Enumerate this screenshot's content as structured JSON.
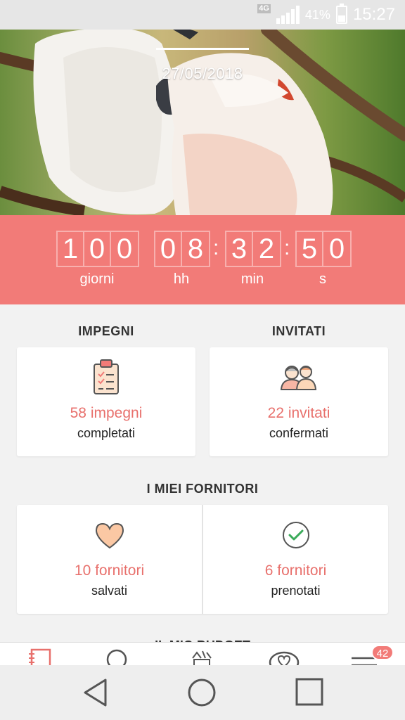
{
  "status_bar": {
    "network": "4G",
    "battery_percent": "41%",
    "battery_level": 0.41,
    "time": "15:27"
  },
  "hero": {
    "date": "27/05/2018"
  },
  "countdown": {
    "days": [
      "1",
      "0",
      "0"
    ],
    "hours": [
      "0",
      "8"
    ],
    "minutes": [
      "3",
      "2"
    ],
    "seconds": [
      "5",
      "0"
    ],
    "separator": ":",
    "labels": {
      "days": "giorni",
      "hours": "hh",
      "minutes": "min",
      "seconds": "s"
    }
  },
  "impegni": {
    "title": "IMPEGNI",
    "main": "58 impegni",
    "sub": "completati",
    "icon": "clipboard-checklist-icon"
  },
  "invitati": {
    "title": "INVITATI",
    "main": "22 invitati",
    "sub": "confermati",
    "icon": "guests-icon"
  },
  "fornitori": {
    "title": "I MIEI FORNITORI",
    "saved_main": "10 fornitori",
    "saved_sub": "salvati",
    "saved_icon": "heart-icon",
    "booked_main": "6 fornitori",
    "booked_sub": "prenotati",
    "booked_icon": "check-circle-icon"
  },
  "next_section_partial_title": "IL MIO BUDGET",
  "tabbar": {
    "tabs": [
      "notebook-icon",
      "search-icon",
      "vendors-icon",
      "community-heart-icon",
      "menu-icon"
    ],
    "menu_badge": "42"
  },
  "colors": {
    "accent": "#f27b78",
    "accent_text": "#e8706c",
    "background": "#f2f2f2"
  }
}
